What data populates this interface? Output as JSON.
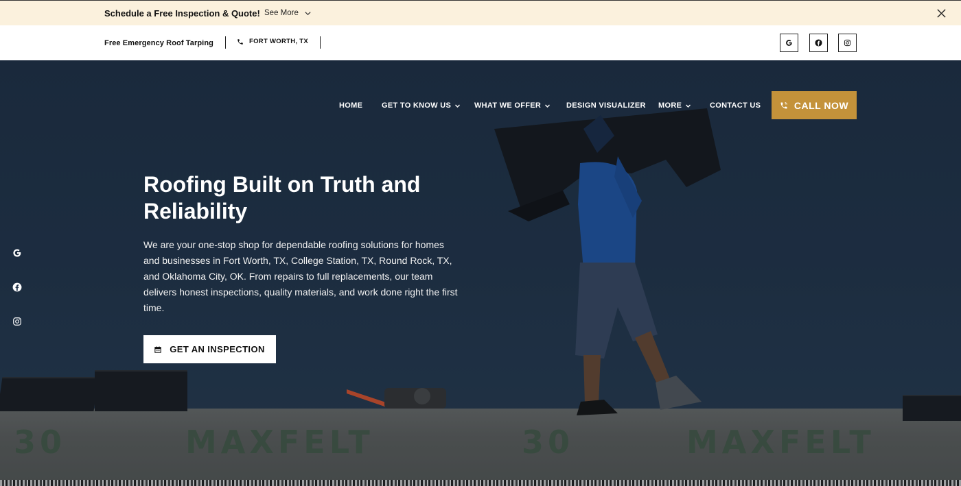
{
  "announcement": {
    "title": "Schedule a Free Inspection & Quote!",
    "see_more": "See More"
  },
  "utility": {
    "tarping": "Free Emergency Roof Tarping",
    "location": "FORT WORTH, TX"
  },
  "nav": {
    "items": [
      {
        "label": "HOME",
        "dropdown": false
      },
      {
        "label": "GET TO KNOW US",
        "dropdown": true
      },
      {
        "label": "WHAT WE OFFER",
        "dropdown": true
      },
      {
        "label": "DESIGN VISUALIZER",
        "dropdown": false
      },
      {
        "label": "MORE",
        "dropdown": true
      },
      {
        "label": "CONTACT US",
        "dropdown": false
      }
    ],
    "call_label": "CALL NOW"
  },
  "hero": {
    "title": "Roofing Built on Truth and Reliability",
    "description": "We are your one-stop shop for dependable roofing solutions for homes and businesses in Fort Worth, TX, College Station, TX, Round Rock, TX, and Oklahoma City, OK. From repairs to full replacements, our team delivers honest inspections, quality materials, and work done right the first time.",
    "cta_label": "GET AN INSPECTION"
  },
  "roof_print": [
    "30",
    "MAXFELT",
    "30",
    "MAXFELT"
  ],
  "colors": {
    "announcement_bg": "#fbf1dd",
    "accent": "#c4923a",
    "hero_bg": "#1f3147"
  },
  "icons": {
    "social": [
      "google-icon",
      "facebook-icon",
      "instagram-icon"
    ],
    "phone": "phone-icon",
    "calendar": "calendar-icon"
  }
}
